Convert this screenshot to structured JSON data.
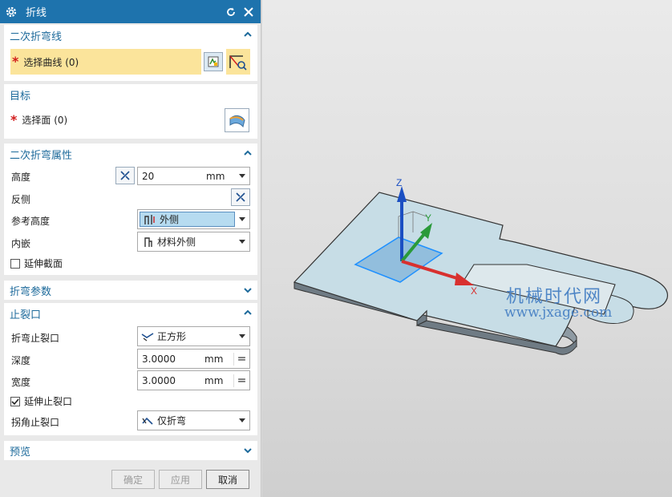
{
  "dialog": {
    "title": "折线",
    "sections": {
      "bend_line": {
        "title": "二次折弯线",
        "select_label": "选择曲线 (0)"
      },
      "target": {
        "title": "目标",
        "select_label": "选择面 (0)"
      },
      "properties": {
        "title": "二次折弯属性",
        "height_label": "高度",
        "height_value": "20",
        "height_unit": "mm",
        "reverse_label": "反侧",
        "ref_height_label": "参考高度",
        "ref_height_value": "外侧",
        "inset_label": "内嵌",
        "inset_value": "材料外侧",
        "extend_section_label": "延伸截面",
        "extend_section_checked": false
      },
      "bend_params": {
        "title": "折弯参数"
      },
      "relief": {
        "title": "止裂口",
        "bend_relief_label": "折弯止裂口",
        "bend_relief_value": "正方形",
        "depth_label": "深度",
        "depth_value": "3.0000",
        "depth_unit": "mm",
        "width_label": "宽度",
        "width_value": "3.0000",
        "width_unit": "mm",
        "extend_relief_label": "延伸止裂口",
        "extend_relief_checked": true,
        "corner_relief_label": "拐角止裂口",
        "corner_relief_value": "仅折弯"
      },
      "preview": {
        "title": "预览"
      }
    },
    "buttons": {
      "ok": "确定",
      "apply": "应用",
      "cancel": "取消"
    }
  },
  "viewport": {
    "axes": {
      "x": "X",
      "y": "Y",
      "z": "Z"
    },
    "watermark_cn": "机械时代网",
    "watermark_url": "www.jxage.com"
  },
  "colors": {
    "title_bar": "#1e73ad",
    "section_header": "#1d6a9b",
    "highlight": "#fbe49b",
    "required": "#d21c1c"
  }
}
